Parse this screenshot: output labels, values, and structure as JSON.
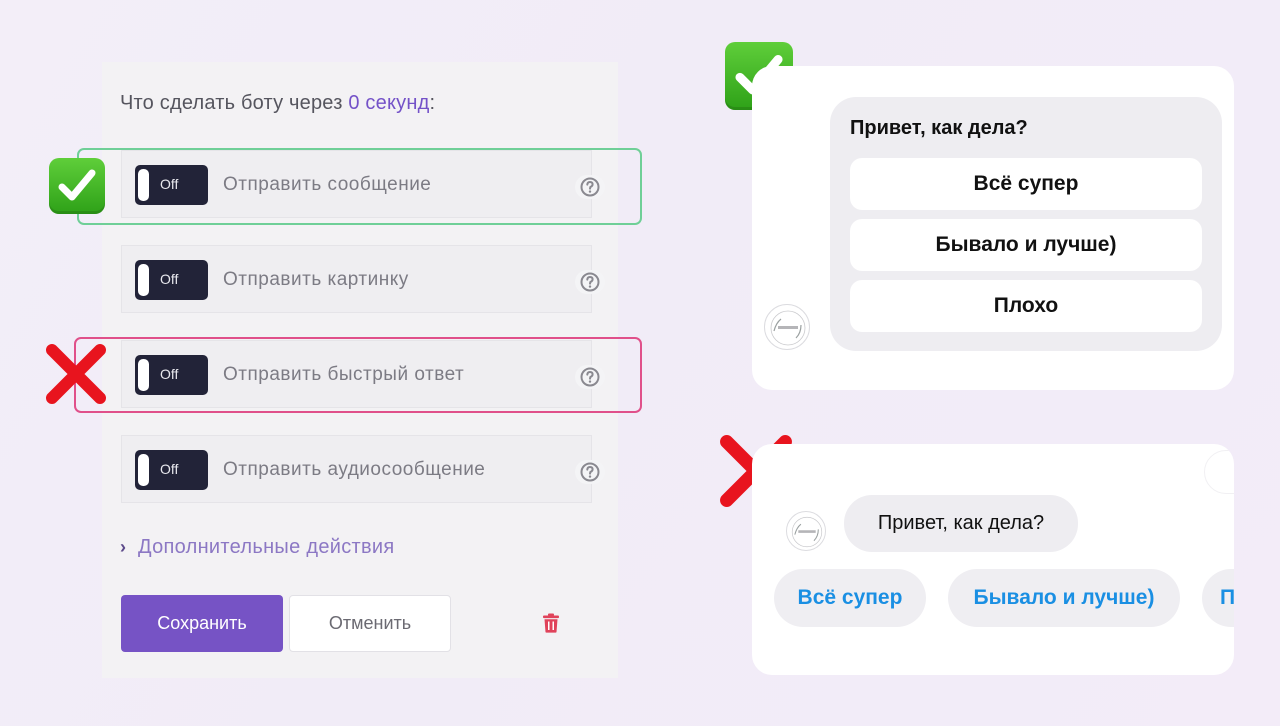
{
  "settings": {
    "heading_prefix": "Что сделать боту через",
    "heading_delay": "0 секунд",
    "heading_suffix": ":",
    "toggle_off_label": "Off",
    "actions": [
      {
        "label": "Отправить сообщение",
        "state": "Off"
      },
      {
        "label": "Отправить картинку",
        "state": "Off"
      },
      {
        "label": "Отправить быстрый ответ",
        "state": "Off"
      },
      {
        "label": "Отправить аудиосообщение",
        "state": "Off"
      }
    ],
    "more_actions": "Дополнительные действия",
    "save_label": "Сохранить",
    "cancel_label": "Отменить",
    "icons": {
      "help": "question-circle-icon",
      "delete": "trash-icon",
      "expand": "chevron-right-icon"
    }
  },
  "annotations": {
    "correct_icon": "check-mark-button-icon",
    "wrong_icon": "cross-mark-icon",
    "correct_color": "#6fcf97",
    "wrong_color": "#e0508a"
  },
  "good_example": {
    "message": "Привет, как дела?",
    "buttons": [
      "Всё супер",
      "Бывало и лучше)",
      "Плохо"
    ]
  },
  "bad_example": {
    "message": "Привет, как дела?",
    "quick_replies": [
      "Всё супер",
      "Бывало и лучше)",
      "П"
    ],
    "reply_color": "#1a8fe3"
  },
  "colors": {
    "accent": "#7653c5",
    "toggle_bg": "#222338",
    "panel_bg": "#f3f2f4"
  }
}
